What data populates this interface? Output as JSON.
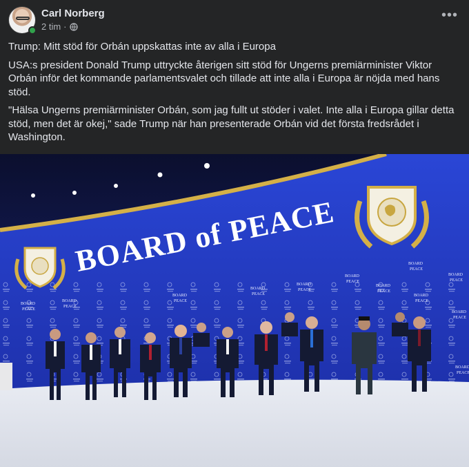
{
  "post": {
    "author": "Carl Norberg",
    "time": "2 tim",
    "separator": "·",
    "more_label": "•••",
    "paragraphs": [
      "Trump: Mitt stöd för Orbán uppskattas inte av alla i Europa",
      "USA:s president Donald Trump uttryckte återigen sitt stöd för Ungerns premiärminister Viktor Orbán inför det kommande parlamentsvalet och tillade att inte alla i Europa är nöjda med hans stöd.",
      "\"Hälsa Ungerns premiärminister Orbán, som jag fullt ut stöder i valet. Inte alla i Europa gillar detta stöd, men det är okej,\" sade Trump när han presenterade Orbán vid det första fredsrådet i Washington."
    ]
  },
  "photo": {
    "backdrop_text": "BOARD of PEACE",
    "small_logo_text_line1": "BOARD",
    "small_logo_text_line2": "PEACE"
  },
  "colors": {
    "background": "#242526",
    "text": "#e4e6eb",
    "secondary": "#b0b3b8",
    "online": "#31a24c",
    "stage_blue": "#1b2fb0",
    "gold": "#d4b048"
  }
}
